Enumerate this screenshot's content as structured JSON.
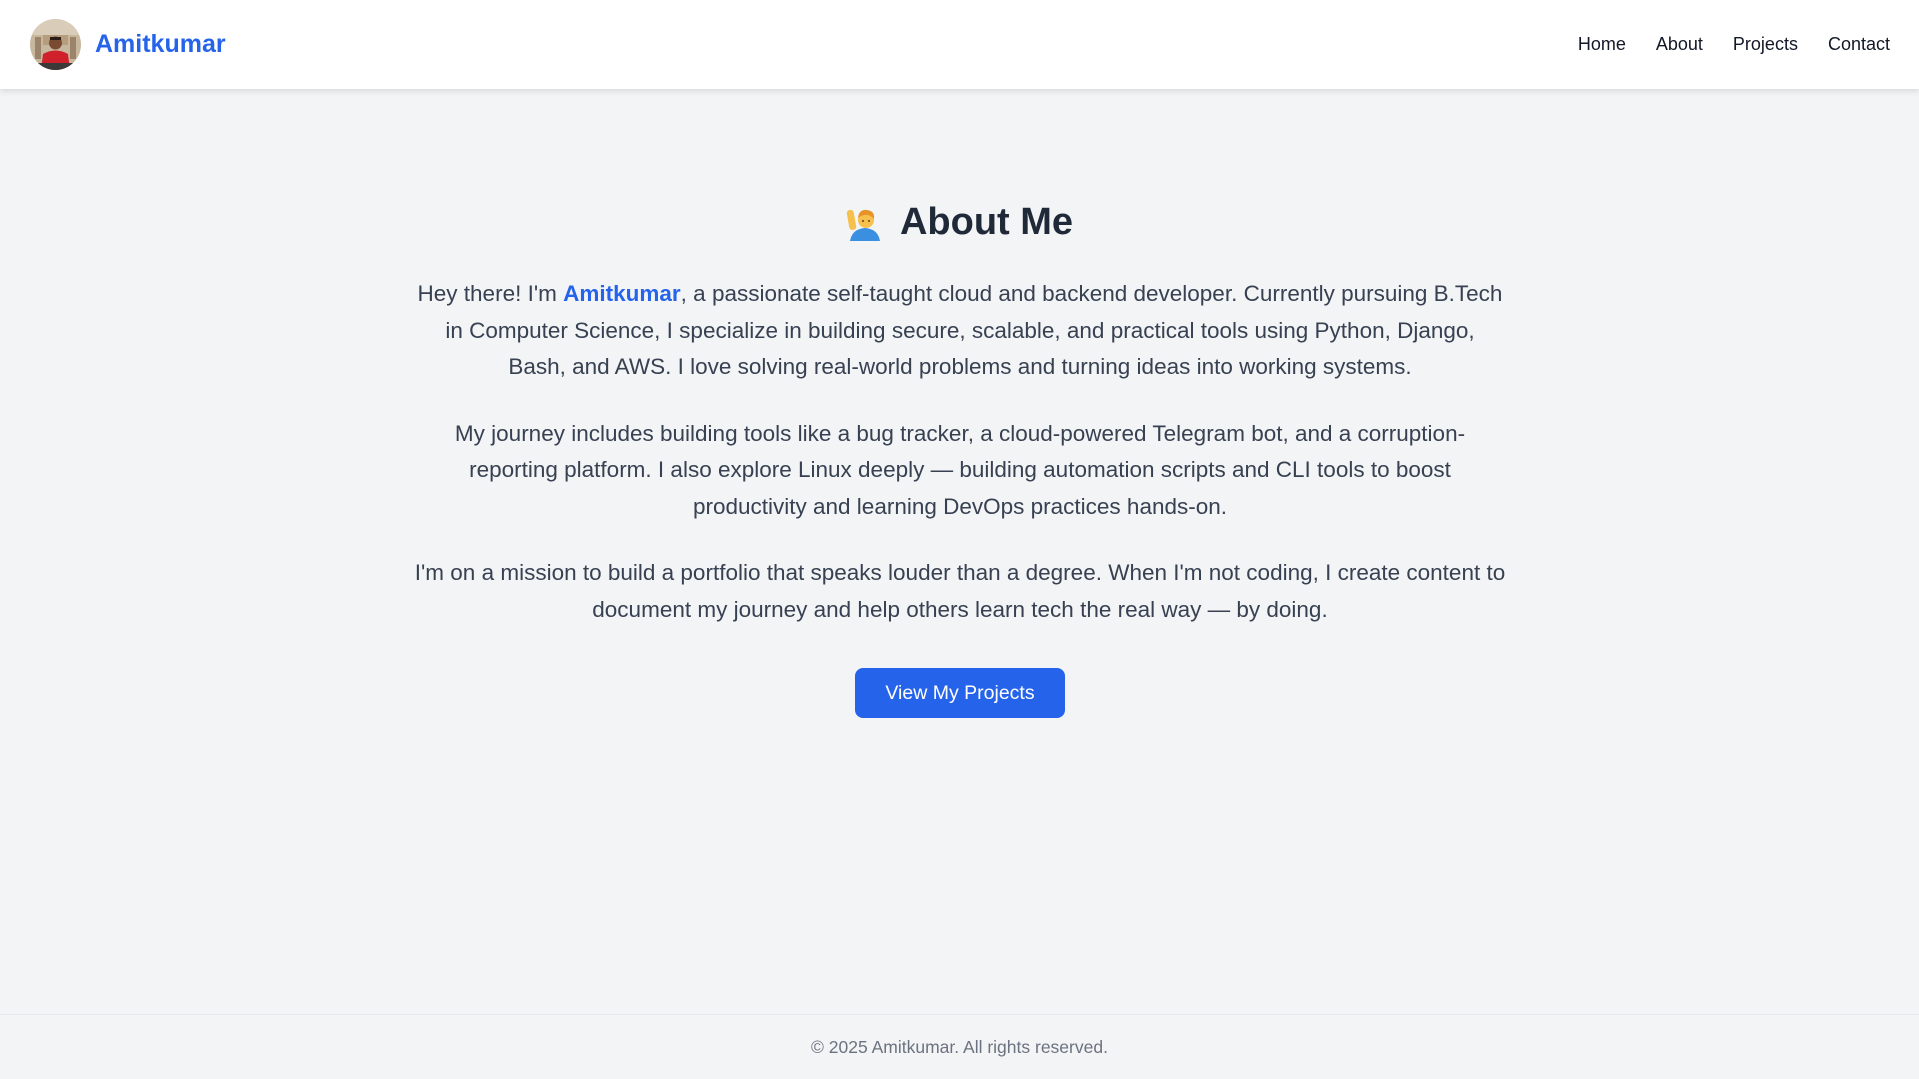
{
  "header": {
    "brand_name": "Amitkumar",
    "avatar_icon": "profile-photo-icon",
    "nav": [
      {
        "label": "Home"
      },
      {
        "label": "About"
      },
      {
        "label": "Projects"
      },
      {
        "label": "Contact"
      }
    ]
  },
  "about": {
    "title": "About Me",
    "title_icon": "raising-hand-icon",
    "p1_before": "Hey there! I'm ",
    "p1_name": "Amitkumar",
    "p1_after": ", a passionate self-taught cloud and backend developer. Currently pursuing B.Tech in Computer Science, I specialize in building secure, scalable, and practical tools using Python, Django, Bash, and AWS. I love solving real-world problems and turning ideas into working systems.",
    "p2": "My journey includes building tools like a bug tracker, a cloud-powered Telegram bot, and a corruption-reporting platform. I also explore Linux deeply — building automation scripts and CLI tools to boost productivity and learning DevOps practices hands-on.",
    "p3": "I'm on a mission to build a portfolio that speaks louder than a degree. When I'm not coding, I create content to document my journey and help others learn tech the real way — by doing.",
    "cta_label": "View My Projects"
  },
  "footer": {
    "text": "© 2025 Amitkumar. All rights reserved."
  },
  "colors": {
    "accent": "#2563eb",
    "background": "#f3f4f6",
    "header_bg": "#ffffff",
    "heading": "#1f2937",
    "body_text": "#374151",
    "footer_text": "#6b7280"
  }
}
